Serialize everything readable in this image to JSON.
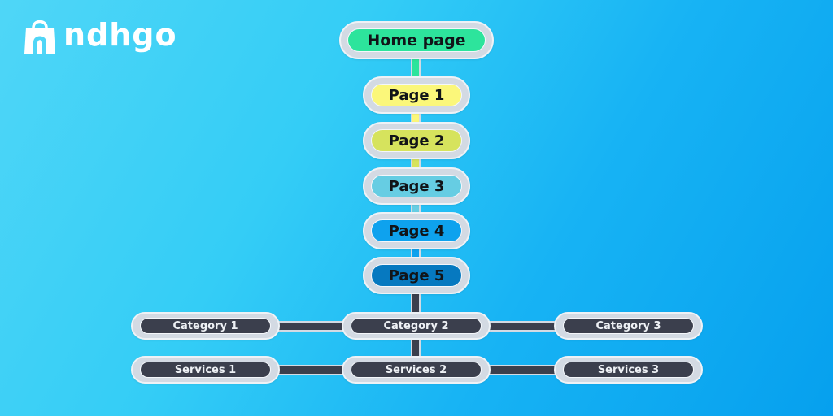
{
  "brand": {
    "name": "ndhgo",
    "logo_icon": "shopping-bag-icon"
  },
  "diagram": {
    "type": "sitemap-hierarchy",
    "root": {
      "label": "Home page",
      "color": "#2de49c"
    },
    "pages": [
      {
        "label": "Page 1",
        "color": "#fbf77a"
      },
      {
        "label": "Page 2",
        "color": "#d6e35d"
      },
      {
        "label": "Page 3",
        "color": "#66cde3"
      },
      {
        "label": "Page 4",
        "color": "#0ea2ee"
      },
      {
        "label": "Page 5",
        "color": "#0679c0"
      }
    ],
    "categories": [
      {
        "label": "Category 1"
      },
      {
        "label": "Category 2"
      },
      {
        "label": "Category 3"
      }
    ],
    "services": [
      {
        "label": "Services 1"
      },
      {
        "label": "Services 2"
      },
      {
        "label": "Services 3"
      }
    ],
    "node_dark_color": "#3b3f4d",
    "node_border_color": "#d3dae3"
  }
}
